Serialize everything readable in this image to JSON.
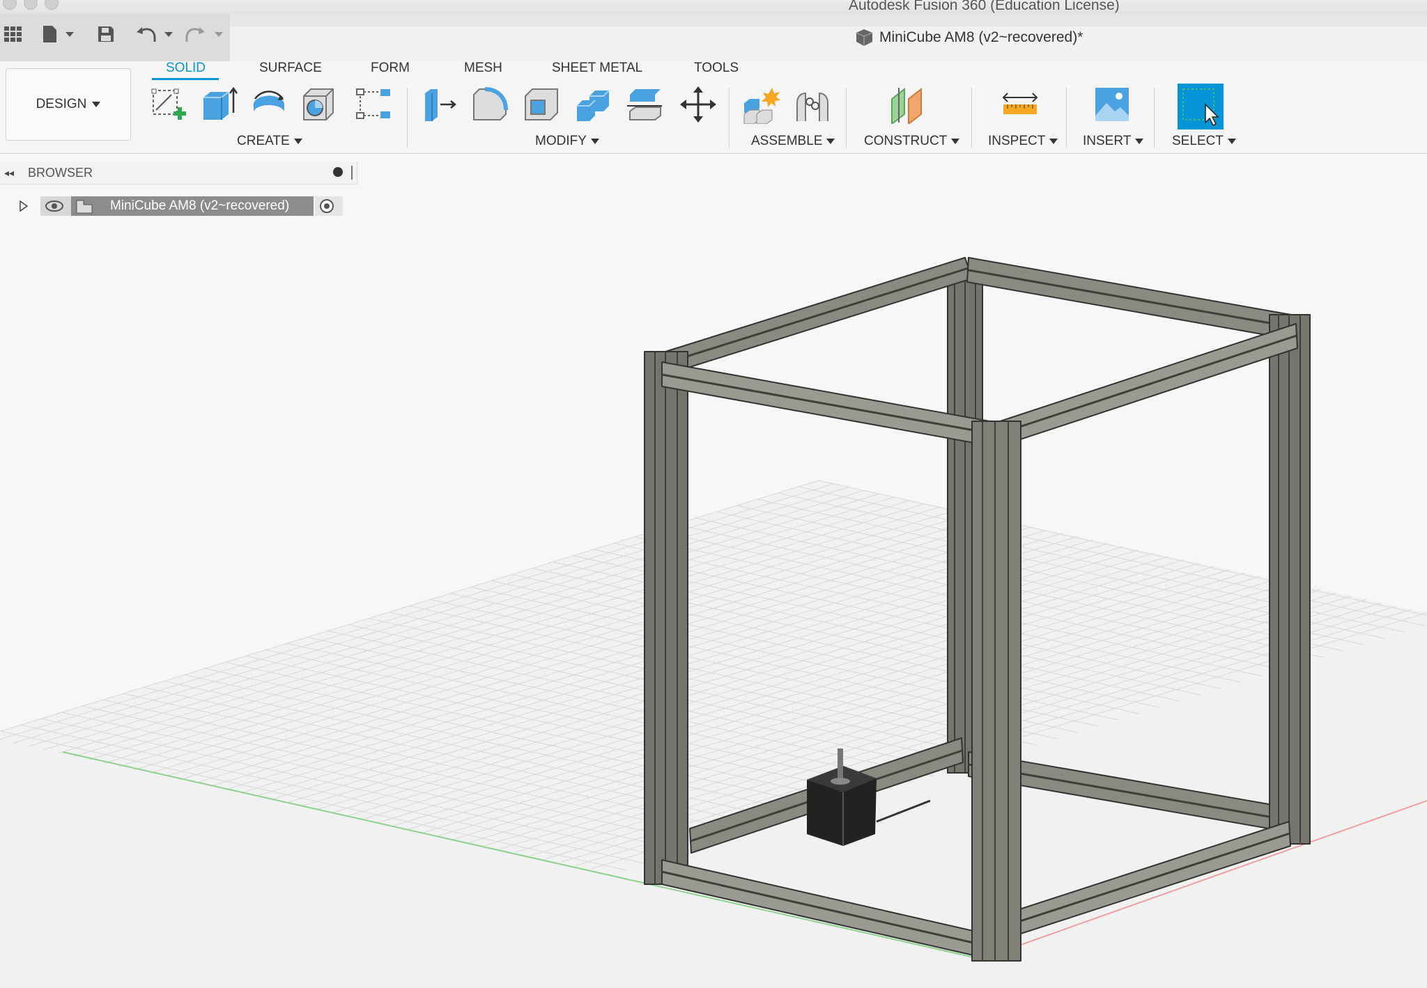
{
  "window": {
    "app_title": "Autodesk Fusion 360 (Education License)"
  },
  "document": {
    "title": "MiniCube AM8 (v2~recovered)*"
  },
  "workspace": {
    "label": "DESIGN"
  },
  "tabs": [
    {
      "label": "SOLID"
    },
    {
      "label": "SURFACE"
    },
    {
      "label": "FORM"
    },
    {
      "label": "MESH"
    },
    {
      "label": "SHEET METAL"
    },
    {
      "label": "TOOLS"
    }
  ],
  "groups": {
    "create": "CREATE",
    "modify": "MODIFY",
    "assemble": "ASSEMBLE",
    "construct": "CONSTRUCT",
    "inspect": "INSPECT",
    "insert": "INSERT",
    "select": "SELECT"
  },
  "browser": {
    "label": "BROWSER",
    "root_item": "MiniCube AM8 (v2~recovered)"
  },
  "icons": {
    "apps": "grid-icon",
    "file": "file-icon",
    "save": "save-icon",
    "undo": "undo-icon",
    "redo": "redo-icon",
    "doc": "cube-icon"
  },
  "colors": {
    "accent": "#0696d7",
    "frame": "#6e6e68",
    "motor": "#2a2a2a"
  }
}
